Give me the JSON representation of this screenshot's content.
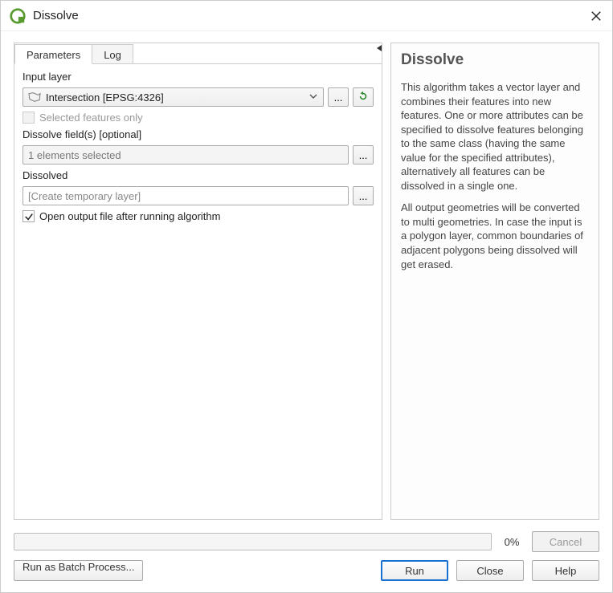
{
  "window": {
    "title": "Dissolve"
  },
  "tabs": {
    "parameters": "Parameters",
    "log": "Log"
  },
  "params": {
    "input_layer_label": "Input layer",
    "input_layer_value": "Intersection [EPSG:4326]",
    "selected_features_label": "Selected features only",
    "dissolve_fields_label": "Dissolve field(s) [optional]",
    "dissolve_fields_value": "1 elements selected",
    "dissolved_label": "Dissolved",
    "dissolved_placeholder": "[Create temporary layer]",
    "open_output_label": "Open output file after running algorithm",
    "browse_dots": "..."
  },
  "help": {
    "title": "Dissolve",
    "p1": "This algorithm takes a vector layer and combines their features into new features. One or more attributes can be specified to dissolve features belonging to the same class (having the same value for the specified attributes), alternatively all features can be dissolved in a single one.",
    "p2": "All output geometries will be converted to multi geometries. In case the input is a polygon layer, common boundaries of adjacent polygons being dissolved will get erased."
  },
  "progress": {
    "percent": "0%"
  },
  "buttons": {
    "cancel": "Cancel",
    "batch": "Run as Batch Process...",
    "run": "Run",
    "close": "Close",
    "help": "Help"
  }
}
